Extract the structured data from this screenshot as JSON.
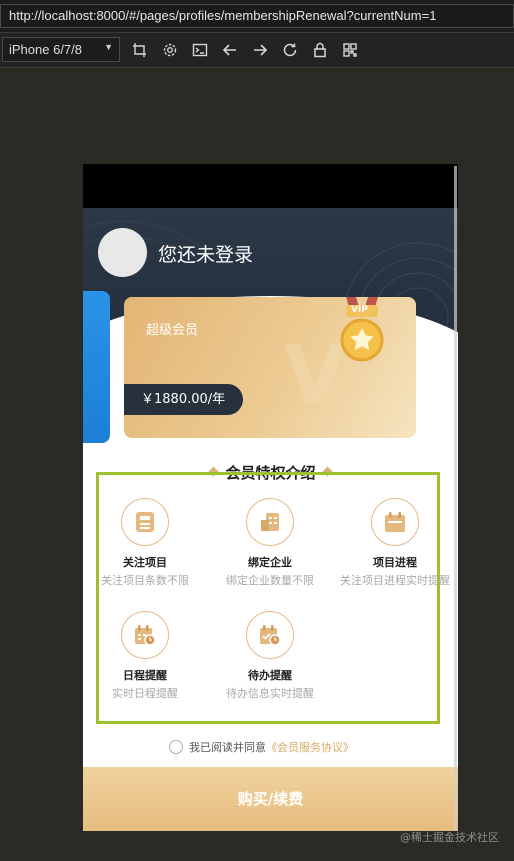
{
  "browser": {
    "url": "http://localhost:8000/#/pages/profiles/membershipRenewal?currentNum=1",
    "device": "iPhone 6/7/8"
  },
  "toolbar_icons": [
    "crop-icon",
    "settings-icon",
    "console-icon",
    "back-icon",
    "forward-icon",
    "reload-icon",
    "lock-icon",
    "qr-icon"
  ],
  "profile": {
    "login_text": "您还未登录"
  },
  "vip_card": {
    "title": "超级会员",
    "price": "￥1880.00/年",
    "medal_text": "VIP"
  },
  "benefits": {
    "title": "会员特权介绍",
    "items": [
      {
        "name": "关注项目",
        "desc": "关注项目条数不限",
        "icon": "document-icon"
      },
      {
        "name": "绑定企业",
        "desc": "绑定企业数量不限",
        "icon": "enterprise-icon"
      },
      {
        "name": "项目进程",
        "desc": "关注项目进程实时提醒",
        "icon": "calendar-icon"
      },
      {
        "name": "日程提醒",
        "desc": "实时日程提醒",
        "icon": "schedule-icon"
      },
      {
        "name": "待办提醒",
        "desc": "待办信息实时提醒",
        "icon": "todo-icon"
      }
    ]
  },
  "agreement": {
    "prefix": "我已阅读并同意",
    "link": "《会员服务协议》"
  },
  "buy_button": "购买/续费",
  "watermark": "@稀土掘金技术社区",
  "colors": {
    "gold": "#e4b87e",
    "highlight_border": "#9ec12d",
    "dark_header": "#2c3847",
    "blue_card": "#2a93e8"
  }
}
